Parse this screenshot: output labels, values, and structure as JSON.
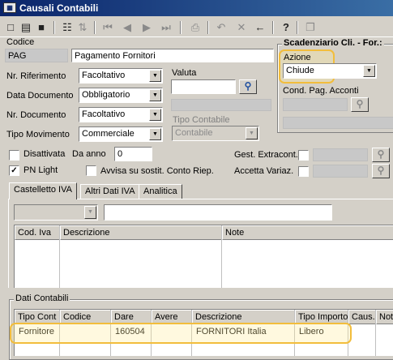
{
  "window": {
    "title": "Causali Contabili",
    "icon": "window-app-icon"
  },
  "toolbar": {
    "buttons": [
      {
        "name": "new-icon",
        "glyph": "□"
      },
      {
        "name": "open-icon",
        "glyph": "▤"
      },
      {
        "name": "save-icon",
        "glyph": "■"
      },
      {
        "name": "find-icon",
        "glyph": "☷"
      },
      {
        "name": "sort-icon",
        "glyph": "⇅"
      },
      {
        "name": "first-record-icon",
        "glyph": "⏮"
      },
      {
        "name": "previous-record-icon",
        "glyph": "◀"
      },
      {
        "name": "next-record-icon",
        "glyph": "▶"
      },
      {
        "name": "last-record-icon",
        "glyph": "⏭"
      },
      {
        "name": "print-icon",
        "glyph": "⎙"
      },
      {
        "name": "undo-icon",
        "glyph": "↶"
      },
      {
        "name": "delete-icon",
        "glyph": "✕"
      },
      {
        "name": "exit-icon",
        "glyph": "←"
      },
      {
        "name": "help-icon",
        "glyph": "?"
      },
      {
        "name": "copy-icon",
        "glyph": "❐"
      }
    ]
  },
  "header": {
    "codice_label": "Codice",
    "codice_value": "PAG",
    "descrizione_value": "Pagamento Fornitori"
  },
  "left_form": {
    "nr_riferimento": {
      "label": "Nr. Riferimento",
      "value": "Facoltativo"
    },
    "data_documento": {
      "label": "Data Documento",
      "value": "Obbligatorio"
    },
    "nr_documento": {
      "label": "Nr. Documento",
      "value": "Facoltativo"
    },
    "tipo_movimento": {
      "label": "Tipo Movimento",
      "value": "Commerciale"
    }
  },
  "mid_form": {
    "valuta": {
      "label": "Valuta",
      "value": ""
    },
    "tipo_contabile": {
      "label": "Tipo Contabile",
      "value": "Contabile"
    }
  },
  "scadenziario": {
    "title": "Scadenziario Cli. - For.:",
    "azione_label": "Azione",
    "azione_value": "Chiude",
    "cond_pag_label": "Cond. Pag. Acconti",
    "cond_pag_value": ""
  },
  "options": {
    "disattivata": {
      "label": "Disattivata",
      "checked": false
    },
    "da_anno": {
      "label": "Da anno",
      "value": "0"
    },
    "pn_light": {
      "label": "PN Light",
      "checked": true
    },
    "avvisa": {
      "label": "Avvisa su sostit. Conto Riep.",
      "checked": false
    },
    "gest_extracont": {
      "label": "Gest. Extracont.",
      "checked": false,
      "value": ""
    },
    "accetta_variaz": {
      "label": "Accetta Variaz.",
      "checked": false,
      "value": ""
    }
  },
  "tabs": [
    {
      "label": "Castelletto IVA",
      "active": true
    },
    {
      "label": "Altri Dati IVA",
      "active": false
    },
    {
      "label": "Analitica",
      "active": false
    }
  ],
  "iva_panel": {
    "combo_value": "",
    "text_value": "",
    "columns": [
      "Cod. Iva",
      "Descrizione",
      "Note"
    ]
  },
  "dati_contabili": {
    "title": "Dati Contabili",
    "columns": [
      "Tipo Cont",
      "Codice",
      "Dare",
      "Avere",
      "Descrizione",
      "Tipo Importo",
      "Caus.",
      "Note"
    ],
    "rows": [
      [
        "Fornitore",
        "",
        "160504",
        "",
        "FORNITORI Italia",
        "Libero",
        "",
        ""
      ]
    ]
  },
  "colors": {
    "highlight": "#f2bd3c",
    "title_bar": "#0a246a",
    "window_bg": "#d4d0c8"
  }
}
